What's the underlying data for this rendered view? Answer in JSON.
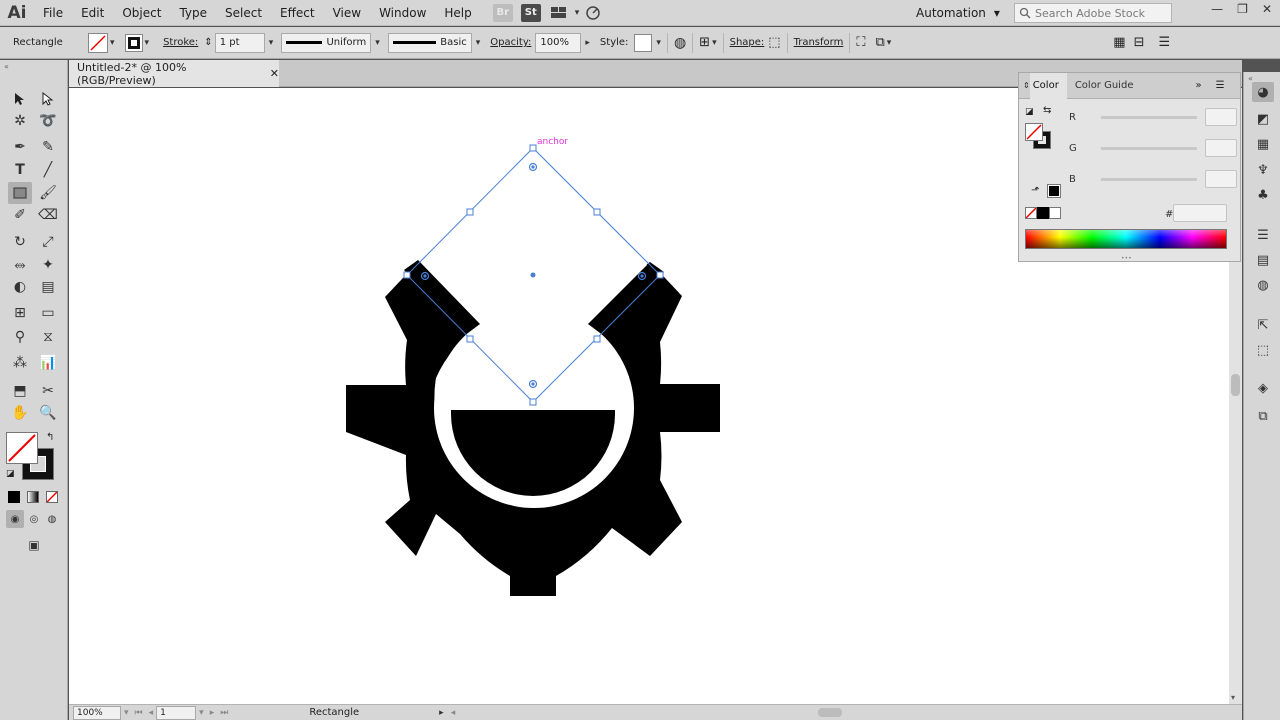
{
  "app": {
    "logo": "Ai"
  },
  "menu": [
    "File",
    "Edit",
    "Object",
    "Type",
    "Select",
    "Effect",
    "View",
    "Window",
    "Help"
  ],
  "menubar": {
    "bridge_icon": "Br",
    "stock_icon": "St",
    "workspace": "Automation",
    "search_placeholder": "Search Adobe Stock"
  },
  "controlbar": {
    "object_type": "Rectangle",
    "stroke_label": "Stroke:",
    "stroke_weight": "1 pt",
    "profile": "Uniform",
    "brush": "Basic",
    "opacity_label": "Opacity:",
    "opacity_value": "100%",
    "style_label": "Style:",
    "shape_label": "Shape:",
    "transform_label": "Transform"
  },
  "document": {
    "tab_title": "Untitled-2* @ 100% (RGB/Preview)",
    "close_glyph": "✕"
  },
  "canvas": {
    "smart_guide_label": "anchor",
    "selection_color": "#4a7fd4",
    "artwork_color": "#000000"
  },
  "statusbar": {
    "zoom": "100%",
    "artboard": "1",
    "current_tool": "Rectangle"
  },
  "color_panel": {
    "tabs": [
      "Color",
      "Color Guide"
    ],
    "channels": [
      "R",
      "G",
      "B"
    ],
    "hex_label": "#"
  }
}
